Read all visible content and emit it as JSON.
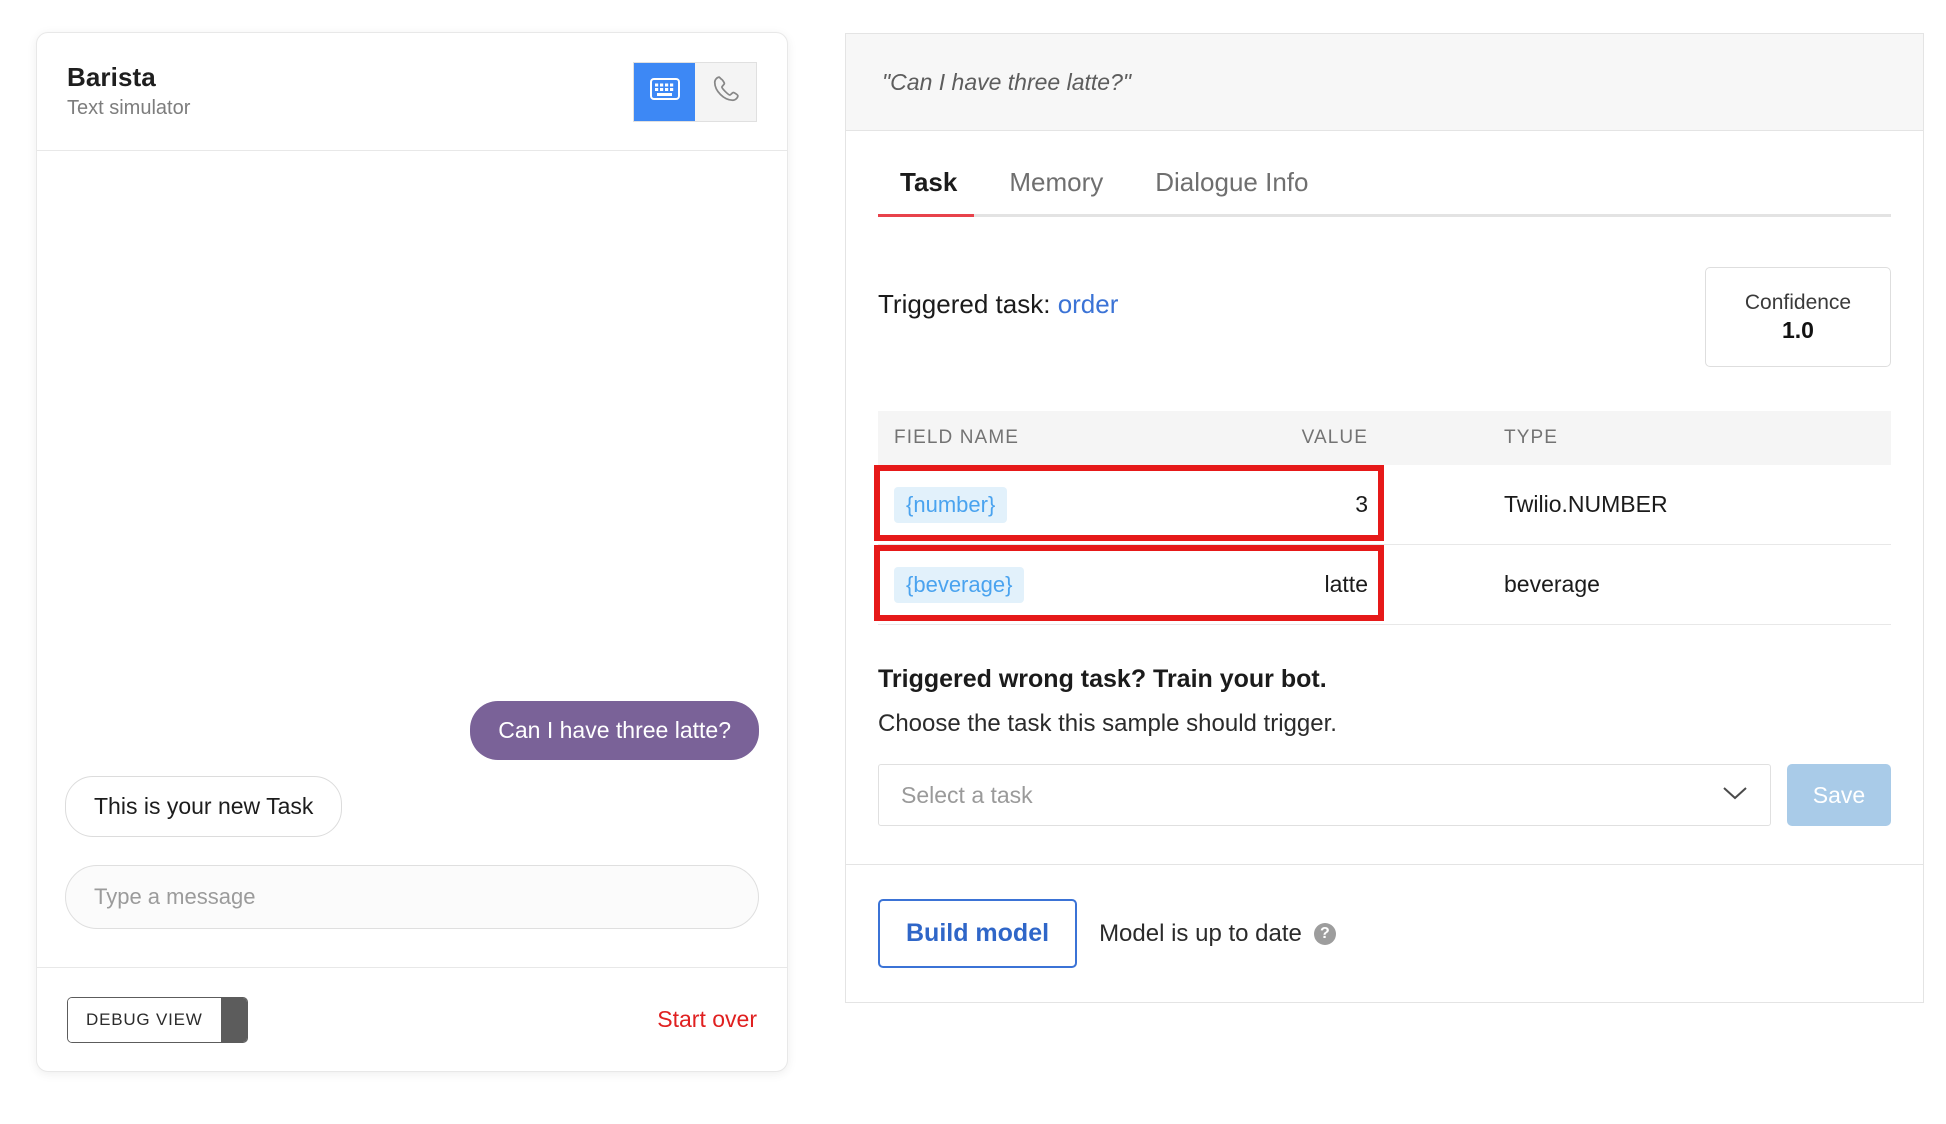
{
  "simulator": {
    "title": "Barista",
    "subtitle": "Text simulator",
    "modes": [
      {
        "name": "text-mode",
        "icon": "keyboard-icon",
        "active": true
      },
      {
        "name": "voice-mode",
        "icon": "phone-icon",
        "active": false
      }
    ],
    "messages": [
      {
        "side": "right",
        "sender": "user",
        "text": "Can I have three latte?"
      },
      {
        "side": "left",
        "sender": "bot",
        "text": "This is your new Task"
      }
    ],
    "composer_placeholder": "Type a message",
    "composer_value": "",
    "debug_toggle_label": "DEBUG VIEW",
    "start_over_label": "Start over",
    "colors": {
      "user_bubble": "#7a6298",
      "mode_active": "#3d88f5",
      "start_over": "#e02020"
    }
  },
  "inspector": {
    "quote": "\"Can I have three latte?\"",
    "tabs": [
      {
        "label": "Task",
        "active": true
      },
      {
        "label": "Memory",
        "active": false
      },
      {
        "label": "Dialogue Info",
        "active": false
      }
    ],
    "triggered_task_prefix": "Triggered task:",
    "triggered_task_name": "order",
    "confidence_label": "Confidence",
    "confidence_value": "1.0",
    "table": {
      "columns": [
        "FIELD NAME",
        "VALUE",
        "TYPE"
      ],
      "rows": [
        {
          "field": "{number}",
          "value": "3",
          "type": "Twilio.NUMBER",
          "highlighted": true
        },
        {
          "field": "{beverage}",
          "value": "latte",
          "type": "beverage",
          "highlighted": true
        }
      ]
    },
    "train": {
      "title": "Triggered wrong task? Train your bot.",
      "subtitle": "Choose the task this sample should trigger.",
      "select_placeholder": "Select a task",
      "select_value": "",
      "save_label": "Save",
      "save_disabled": true
    },
    "build": {
      "button_label": "Build model",
      "status_text": "Model is up to date",
      "help_glyph": "?"
    },
    "colors": {
      "active_tab_underline": "#e8424b",
      "link": "#3b73d6",
      "chip_bg": "#e2f1fb",
      "chip_text": "#4aa3ef",
      "annotation": "#e61919"
    }
  }
}
